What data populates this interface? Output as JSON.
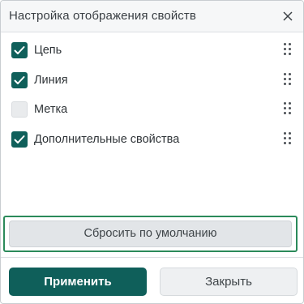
{
  "dialog": {
    "title": "Настройка отображения свойств",
    "close_icon": "close-icon"
  },
  "properties": [
    {
      "label": "Цепь",
      "checked": true
    },
    {
      "label": "Линия",
      "checked": true
    },
    {
      "label": "Метка",
      "checked": false
    },
    {
      "label": "Дополнительные свойства",
      "checked": true
    }
  ],
  "reset_label": "Сбросить по умолчанию",
  "footer": {
    "apply_label": "Применить",
    "close_label": "Закрыть"
  },
  "colors": {
    "accent": "#0f5f5a",
    "focus_outline": "#2b8a5a"
  }
}
